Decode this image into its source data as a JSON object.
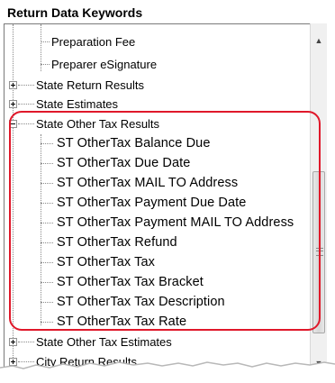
{
  "panel": {
    "title": "Return Data Keywords"
  },
  "tree": {
    "items": [
      {
        "label": "Preparation Fee",
        "type": "leaf"
      },
      {
        "label": "Preparer eSignature",
        "type": "leaf"
      },
      {
        "label": "State Return Results",
        "type": "collapsed"
      },
      {
        "label": "State Estimates",
        "type": "collapsed"
      },
      {
        "label": "State Other Tax Results",
        "type": "expanded"
      },
      {
        "label": "ST OtherTax Balance Due",
        "type": "leaf"
      },
      {
        "label": "ST OtherTax Due Date",
        "type": "leaf"
      },
      {
        "label": "ST OtherTax MAIL TO Address",
        "type": "leaf"
      },
      {
        "label": "ST OtherTax Payment Due Date",
        "type": "leaf"
      },
      {
        "label": "ST OtherTax Payment MAIL TO Address",
        "type": "leaf"
      },
      {
        "label": "ST OtherTax Refund",
        "type": "leaf"
      },
      {
        "label": "ST OtherTax Tax",
        "type": "leaf"
      },
      {
        "label": "ST OtherTax Tax Bracket",
        "type": "leaf"
      },
      {
        "label": "ST OtherTax Tax Description",
        "type": "leaf"
      },
      {
        "label": "ST OtherTax Tax Rate",
        "type": "leaf"
      },
      {
        "label": "State Other Tax Estimates",
        "type": "collapsed"
      },
      {
        "label": "City Return Results",
        "type": "collapsed"
      }
    ]
  },
  "scrollbar": {
    "up_glyph": "▲",
    "down_glyph": "▼"
  },
  "colors": {
    "highlight": "#e0182a",
    "tree_line": "#8a8a8a"
  }
}
